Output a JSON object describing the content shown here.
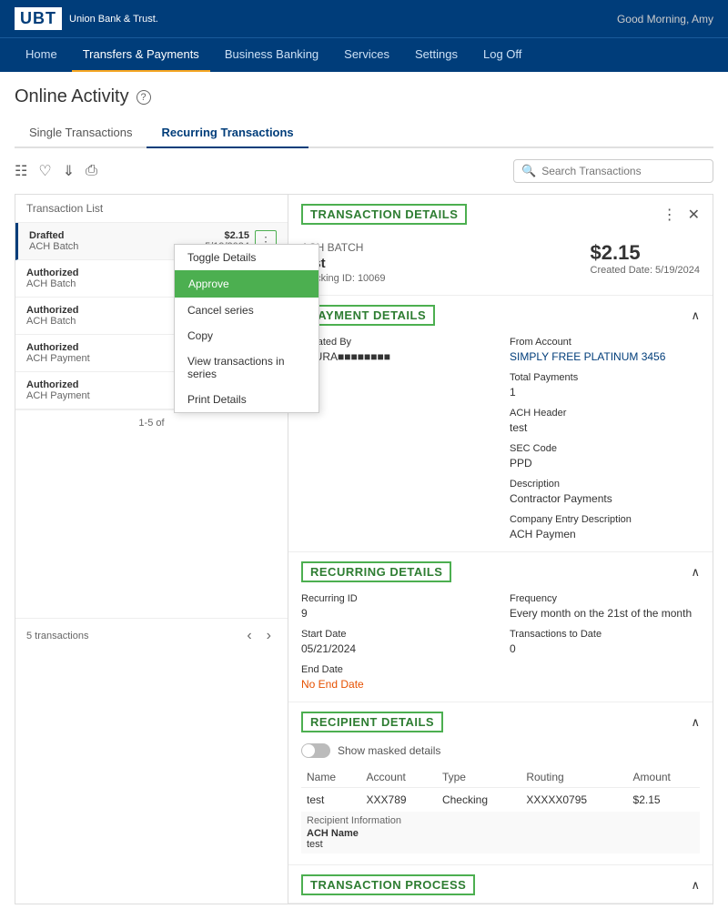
{
  "topbar": {
    "logo": "UBT",
    "bank_name": "Union Bank & Trust.",
    "greeting": "Good Morning, Amy"
  },
  "nav": {
    "items": [
      {
        "label": "Home",
        "active": false
      },
      {
        "label": "Transfers & Payments",
        "active": true
      },
      {
        "label": "Business Banking",
        "active": false
      },
      {
        "label": "Services",
        "active": false
      },
      {
        "label": "Settings",
        "active": false
      },
      {
        "label": "Log Off",
        "active": false
      }
    ]
  },
  "page": {
    "title": "Online Activity",
    "help_icon": "?"
  },
  "tabs": [
    {
      "label": "Single Transactions",
      "active": false
    },
    {
      "label": "Recurring Transactions",
      "active": true
    }
  ],
  "toolbar": {
    "search_placeholder": "Search Transactions",
    "icons": [
      "filter-icon",
      "favorite-icon",
      "download-icon",
      "print-icon"
    ]
  },
  "transaction_list": {
    "header": "Transaction List",
    "items": [
      {
        "status": "Drafted",
        "type": "ACH Batch",
        "amount": "$2.15",
        "date": "5/19/2024",
        "selected": true,
        "has_menu": true
      },
      {
        "status": "Authorized",
        "type": "ACH Batch",
        "amount": "",
        "date": "",
        "selected": false,
        "has_menu": false
      },
      {
        "status": "Authorized",
        "type": "ACH Batch",
        "amount": "",
        "date": "",
        "selected": false,
        "has_menu": false
      },
      {
        "status": "Authorized",
        "type": "ACH Payment",
        "amount": "",
        "date": "",
        "selected": false,
        "has_menu": false
      },
      {
        "status": "Authorized",
        "type": "ACH Payment",
        "amount": "",
        "date": "",
        "selected": false,
        "has_menu": false
      }
    ],
    "page_info": "1-5 of",
    "count": "5 transactions"
  },
  "context_menu": {
    "items": [
      {
        "label": "Toggle Details",
        "type": "normal",
        "divider_after": false
      },
      {
        "label": "Approve",
        "type": "approve",
        "divider_after": false
      },
      {
        "label": "Cancel series",
        "type": "normal",
        "divider_after": false
      },
      {
        "label": "Copy",
        "type": "normal",
        "divider_after": false
      },
      {
        "label": "View transactions in series",
        "type": "normal",
        "divider_after": false
      },
      {
        "label": "Print Details",
        "type": "normal",
        "divider_after": false
      }
    ]
  },
  "transaction_details": {
    "section_title": "TRANSACTION DETAILS",
    "type": "ACH BATCH",
    "name": "test",
    "tracking": "Tracking ID: 10069",
    "amount": "$2.15",
    "created_date": "Created Date: 5/19/2024"
  },
  "payment_details": {
    "section_title": "PAYMENT DETAILS",
    "fields": [
      {
        "label": "Created By",
        "value": "LAURA■■■■■■■■■"
      },
      {
        "label": "From Account",
        "value": "SIMPLY FREE PLATINUM 3456"
      },
      {
        "label": "Total Payments",
        "value": "1"
      },
      {
        "label": "ACH Header",
        "value": "test"
      },
      {
        "label": "SEC Code",
        "value": "PPD"
      },
      {
        "label": "Description",
        "value": "Contractor Payments"
      },
      {
        "label": "Company Entry Description",
        "value": "ACH Paymen"
      }
    ]
  },
  "recurring_details": {
    "section_title": "RECURRING DETAILS",
    "fields": [
      {
        "label": "Recurring ID",
        "value": "9"
      },
      {
        "label": "Frequency",
        "value": "Every month on the 21st of the month"
      },
      {
        "label": "Start Date",
        "value": "05/21/2024"
      },
      {
        "label": "Transactions to Date",
        "value": "0"
      },
      {
        "label": "End Date",
        "value": "No End Date"
      }
    ]
  },
  "recipient_details": {
    "section_title": "RECIPIENT DETAILS",
    "toggle_label": "Show masked details",
    "columns": [
      "Name",
      "Account",
      "Type",
      "Routing",
      "Amount"
    ],
    "rows": [
      {
        "name": "test",
        "account": "XXX789",
        "type": "Checking",
        "routing": "XXXXX0795",
        "amount": "$2.15"
      }
    ],
    "recipient_info_label": "Recipient Information",
    "ach_name_label": "ACH Name",
    "ach_name_value": "test"
  },
  "transaction_process": {
    "section_title": "TRANSACTION PROCESS"
  }
}
